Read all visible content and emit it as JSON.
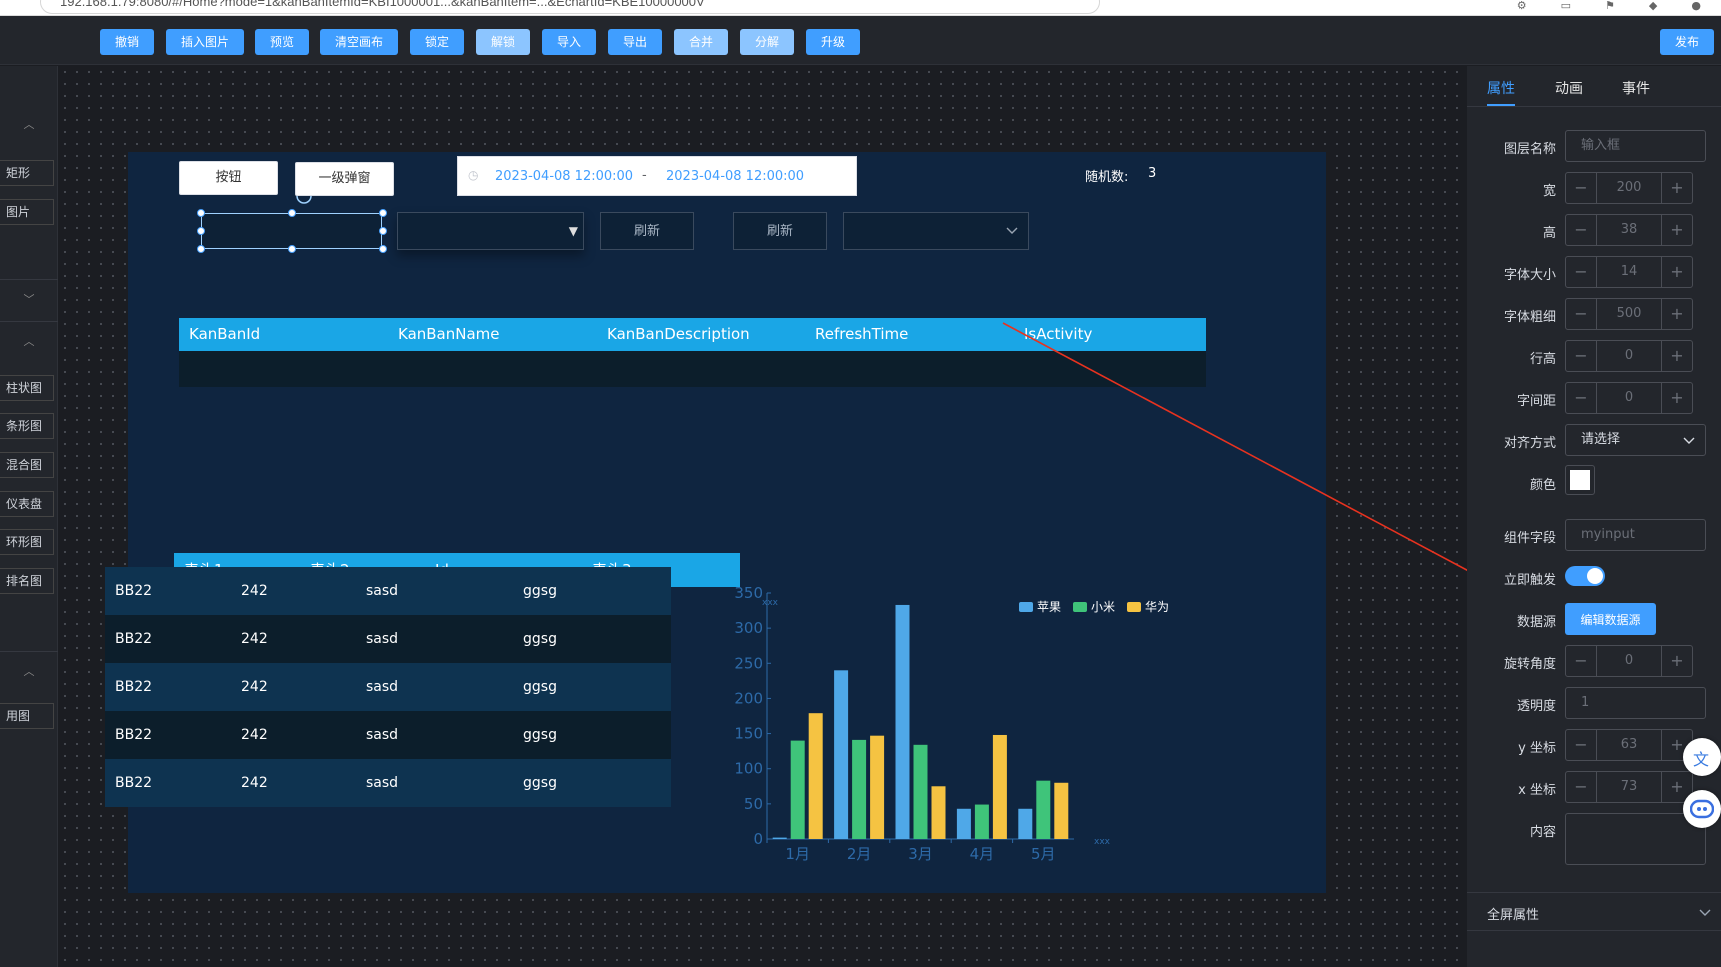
{
  "browser": {
    "url": "192.168.1.79:8080/#/Home?mode=1&kanBanItemId=KBI1000001...&kanBanItem=...&EchartId=KBE10000000V"
  },
  "toolbar": {
    "buttons": [
      "撤销",
      "插入图片",
      "预览",
      "清空画布",
      "锁定",
      "解锁",
      "导入",
      "导出",
      "合并",
      "分解",
      "升级"
    ],
    "publish": "发布"
  },
  "left_sidebar": {
    "group1": [
      "矩形",
      "图片"
    ],
    "charts": [
      "柱状图",
      "条形图",
      "混合图",
      "仪表盘",
      "环形图",
      "排名图"
    ],
    "group3": [
      "用图"
    ]
  },
  "board": {
    "button_label": "按钮",
    "popup_label": "一级弹窗",
    "date_start": "2023-04-08 12:00:00",
    "date_separator": "-",
    "date_end": "2023-04-08 12:00:00",
    "random_label": "随机数:",
    "random_value": "3",
    "refresh1": "刷新",
    "refresh2": "刷新",
    "kanban_table": {
      "columns": [
        "KanBanId",
        "KanBanName",
        "KanBanDescription",
        "RefreshTime",
        "IsActivity"
      ]
    },
    "data_table": {
      "columns": [
        "表头1",
        "表头2",
        "Id",
        "表头3"
      ],
      "rows": [
        [
          "BB22",
          "242",
          "sasd",
          "ggsg"
        ],
        [
          "BB22",
          "242",
          "sasd",
          "ggsg"
        ],
        [
          "BB22",
          "242",
          "sasd",
          "ggsg"
        ],
        [
          "BB22",
          "242",
          "sasd",
          "ggsg"
        ],
        [
          "BB22",
          "242",
          "sasd",
          "ggsg"
        ]
      ]
    }
  },
  "chart_data": {
    "type": "bar",
    "categories": [
      "1月",
      "2月",
      "3月",
      "4月",
      "5月"
    ],
    "series": [
      {
        "name": "苹果",
        "values": [
          2,
          240,
          333,
          43,
          43
        ],
        "color": "#4fa8e8"
      },
      {
        "name": "小米",
        "values": [
          140,
          141,
          134,
          49,
          83
        ],
        "color": "#3fc47a"
      },
      {
        "name": "华为",
        "values": [
          179,
          147,
          75,
          148,
          80
        ],
        "color": "#f5c342"
      }
    ],
    "xlabel": "xxx",
    "ylabel": "xxx",
    "ylim": [
      0,
      350
    ],
    "yticks": [
      "0",
      "50",
      "100",
      "150",
      "200",
      "250",
      "300",
      "350"
    ],
    "legend_position": "top-right"
  },
  "right_panel": {
    "tabs": [
      "属性",
      "动画",
      "事件"
    ],
    "layer_name_label": "图层名称",
    "layer_name_placeholder": "输入框",
    "width_label": "宽",
    "width_value": "200",
    "height_label": "高",
    "height_value": "38",
    "font_size_label": "字体大小",
    "font_size_value": "14",
    "font_weight_label": "字体粗细",
    "font_weight_value": "500",
    "line_height_label": "行高",
    "line_height_value": "0",
    "letter_spacing_label": "字间距",
    "letter_spacing_value": "0",
    "align_label": "对齐方式",
    "align_value": "请选择",
    "color_label": "颜色",
    "field_label": "组件字段",
    "field_value": "myinput",
    "trigger_label": "立即触发",
    "datasource_label": "数据源",
    "datasource_button": "编辑数据源",
    "rotate_label": "旋转角度",
    "rotate_value": "0",
    "opacity_label": "透明度",
    "opacity_value": "1",
    "y_label": "y 坐标",
    "y_value": "63",
    "x_label": "x 坐标",
    "x_value": "73",
    "content_label": "内容",
    "fullscreen_label": "全屏属性",
    "stepper_minus": "−",
    "stepper_plus": "+"
  },
  "colors": {
    "accent": "#409eff",
    "board_bg": "#0f2540",
    "table_head": "#1aa6e6",
    "annotation_arrow": "#e8321f"
  }
}
